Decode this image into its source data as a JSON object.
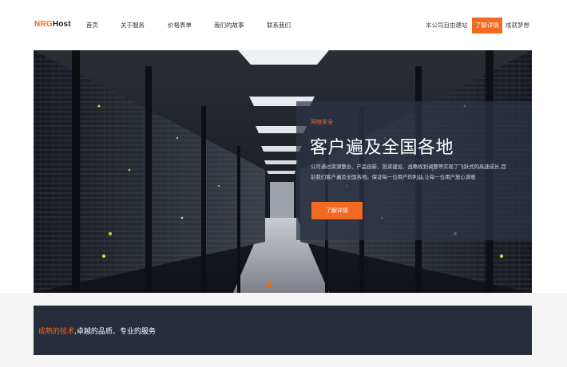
{
  "brand": {
    "accent": "NRG",
    "rest": "Host"
  },
  "nav": {
    "items": [
      {
        "label": "首页"
      },
      {
        "label": "关于服务"
      },
      {
        "label": "价格表单"
      },
      {
        "label": "我们的故事"
      },
      {
        "label": "联系我们"
      }
    ],
    "right_link": "本公司自由建站",
    "cta": "了解详情",
    "right_link_2": "成就梦想"
  },
  "hero": {
    "subtitle": "网络安全",
    "title": "客户遍及全国各地",
    "description": "公司通过资源整合、产品创新、投资建设、战略规划调整等实现了飞跃式的高速成长,目前我们客户遍及全国各地。保证每一位用户的利益,让每一位用户放心满意",
    "button": "了解详情",
    "slide_index": 1,
    "slide_count": 1
  },
  "banner": {
    "highlight": "成熟的技术",
    "rest": ",卓越的品质、专业的服务"
  },
  "colors": {
    "accent": "#f26a21",
    "banner_bg": "#272d3b",
    "overlay": "#2e3448"
  }
}
